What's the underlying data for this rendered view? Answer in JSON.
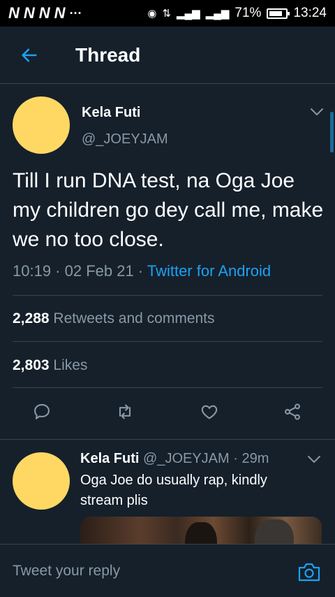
{
  "status_bar": {
    "carriers": [
      "N",
      "N",
      "N",
      "N"
    ],
    "dots": "···",
    "battery": "71%",
    "time": "13:24"
  },
  "header": {
    "title": "Thread"
  },
  "tweet": {
    "name": "Kela Futi",
    "handle": "@_JOEYJAM",
    "text": "Till I run DNA test, na Oga Joe my children go dey call me, make we no too close.",
    "time": "10:19 · 02 Feb 21 ·",
    "source": "Twitter for Android",
    "retweets_count": "2,288",
    "retweets_label": "Retweets and comments",
    "likes_count": "2,803",
    "likes_label": "Likes"
  },
  "reply": {
    "name": "Kela Futi",
    "handle_time": "@_JOEYJAM · 29m",
    "text": "Oga Joe do usually rap, kindly stream plis"
  },
  "compose": {
    "placeholder": "Tweet your reply"
  },
  "icons": {
    "back": "arrow-left-icon",
    "chevron": "chevron-down-icon",
    "reply": "comment-icon",
    "retweet": "retweet-icon",
    "like": "heart-icon",
    "share": "share-icon",
    "camera": "camera-icon"
  },
  "colors": {
    "background": "#15202b",
    "accent": "#1da1f2",
    "muted": "#8899a6",
    "divider": "#38444d",
    "avatar": "#ffd863"
  }
}
